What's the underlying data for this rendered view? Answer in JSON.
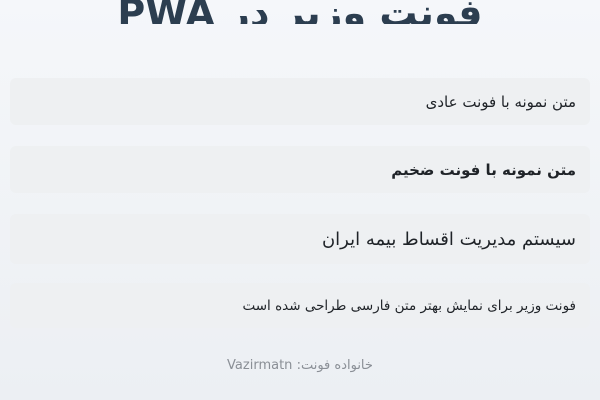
{
  "page": {
    "title": "فونت وزیر در PWA"
  },
  "samples": {
    "regular": "متن نمونه با فونت عادی",
    "bold": "متن نمونه با فونت ضخیم",
    "large": "سیستم مدیریت اقساط بیمه ایران",
    "small": "فونت وزیر برای نمایش بهتر متن فارسی طراحی شده است"
  },
  "footer": {
    "label": "خانواده فونت:",
    "font_family": "Vazirmatn"
  },
  "colors": {
    "title": "#2c3e50",
    "card_background": "#eef0f2",
    "text": "#1f2328",
    "footer_text": "#8a8f96"
  }
}
